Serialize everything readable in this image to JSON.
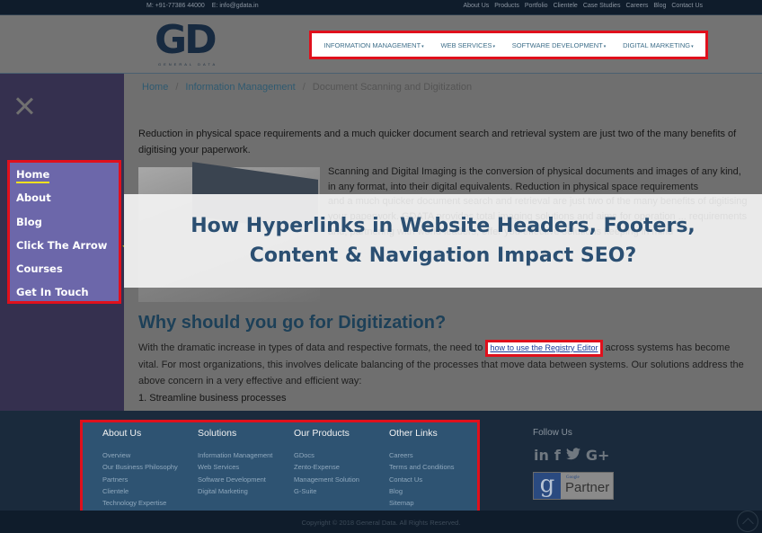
{
  "topbar": {
    "phone": "M: +91-77386 44000",
    "email": "E: info@gdata.in",
    "links": [
      "About Us",
      "Products",
      "Portfolio",
      "Clientele",
      "Case Studies",
      "Careers",
      "Blog",
      "Contact Us"
    ]
  },
  "header": {
    "logo_text": "GD",
    "logo_subtext": "GENERAL DATA",
    "nav": [
      {
        "label": "INFORMATION MANAGEMENT",
        "caret": "▾"
      },
      {
        "label": "WEB SERVICES",
        "caret": "▾"
      },
      {
        "label": "SOFTWARE DEVELOPMENT",
        "caret": "▾"
      },
      {
        "label": "DIGITAL MARKETING",
        "caret": "▾"
      }
    ]
  },
  "sidebar": {
    "close_icon": "close-icon",
    "items": [
      {
        "label": "Home",
        "active": true
      },
      {
        "label": "About"
      },
      {
        "label": "Blog"
      },
      {
        "label": "Click The Arrow",
        "arrow": "⌄"
      },
      {
        "label": "Courses"
      },
      {
        "label": "Get In Touch"
      }
    ]
  },
  "breadcrumb": {
    "items": [
      "Home",
      "Information Management",
      "Document Scanning and Digitization"
    ],
    "separator": "/"
  },
  "content": {
    "intro": "Reduction in physical space requirements and a much quicker document search and retrieval system are just two of the many benefits of digitising your paperwork.",
    "para1": "Scanning and Digital Imaging is the conversion of physical documents and images of any kind, in any format, into their digital equivalents. Reduction in physical space requirements",
    "para1_hidden": "and a much quicker document search and retrieval are just two of the many benefits of digitising your paperwork. GDATA provides total imaging solutions and aims for operation ... requirements and, partnering with world leaders, offer you effective solutions keeping in mind",
    "heading": "Why should you go for Digitization?",
    "para2_before": "With the dramatic increase in types of data and respective formats, the need to ",
    "para2_link": "how to use the Registry Editor",
    "para2_after": " across systems has become vital. For most organizations, this involves delicate balancing of the processes that move data between systems. Our solutions address the above concern in a very effective and efficient way:",
    "list_item_1": "1.  Streamline business processes"
  },
  "banner": {
    "line1": "How Hyperlinks in Website Headers, Footers,",
    "line2": "Content & Navigation Impact SEO?"
  },
  "footer": {
    "columns": [
      {
        "heading": "About Us",
        "links": [
          "Overview",
          "Our Business Philosophy",
          "Partners",
          "Clientele",
          "Technology Expertise"
        ]
      },
      {
        "heading": "Solutions",
        "links": [
          "Information Management",
          "Web Services",
          "Software Development",
          "Digital Marketing"
        ]
      },
      {
        "heading": "Our Products",
        "links": [
          "GDocs",
          "Zento-Expense",
          "Management Solution",
          "G-Suite"
        ]
      },
      {
        "heading": "Other Links",
        "links": [
          "Careers",
          "Terms and Conditions",
          "Contact Us",
          "Blog",
          "Sitemap"
        ]
      }
    ],
    "follow_label": "Follow Us",
    "social": [
      {
        "icon": "linkedin-icon",
        "glyph": "in"
      },
      {
        "icon": "facebook-icon",
        "glyph": "f"
      },
      {
        "icon": "twitter-icon",
        "glyph": "🐦"
      },
      {
        "icon": "google-plus-icon",
        "glyph": "G+"
      }
    ],
    "partner_badge": {
      "g": "g",
      "small": "Google",
      "label": "Partner"
    },
    "copyright": "Copyright © 2018 General Data. All Rights Reserved."
  },
  "colors": {
    "highlight_border": "#e0101c",
    "sidebar_menu_bg": "#6c67aa",
    "active_underline": "#f0e020",
    "banner_text": "#2b4f72",
    "footer_links_bg": "#2e5372"
  }
}
